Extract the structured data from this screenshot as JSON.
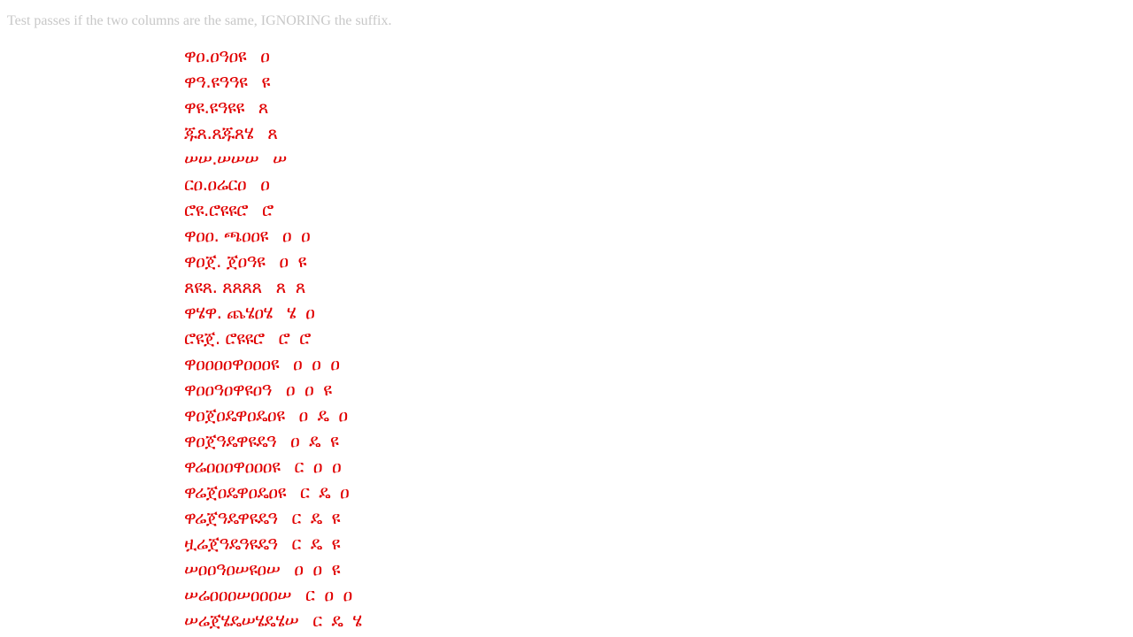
{
  "header": {
    "instruction": "Test passes if the two columns are the same, IGNORING the suffix."
  },
  "rows": [
    {
      "glyphs": "ዋዐ.ዐዓዐዩ",
      "suffix": "ዐ"
    },
    {
      "glyphs": "ዋዓ.ዩዓዓዩ",
      "suffix": "ዩ"
    },
    {
      "glyphs": "ዋዩ.ዩዓዩዩ",
      "suffix": "ጸ"
    },
    {
      "glyphs": "ጁጸ.ጸጁጸሄ",
      "suffix": "ጸ"
    },
    {
      "glyphs": "ሠሠ.ሠሠሠ",
      "suffix": "ሠ"
    },
    {
      "glyphs": "ርዐ.ዐሬርዐ",
      "suffix": "ዐ"
    },
    {
      "glyphs": "ሮዩ.ሮዩዩሮ",
      "suffix": "ሮ"
    },
    {
      "glyphs": "ዋዐዐ. ጫዐዐዩ",
      "suffix": "ዐ ዐ"
    },
    {
      "glyphs": "ዋዐጀ. ጀዐዓዩ",
      "suffix": "ዐ ዩ"
    },
    {
      "glyphs": "ጸዩጸ. ጸጸጸጸ",
      "suffix": "ጸ ጸ"
    },
    {
      "glyphs": "ዋሄዋ. ጨሄዐሄ",
      "suffix": "ሄ ዐ"
    },
    {
      "glyphs": "ሮዩጀ. ሮዩዩሮ",
      "suffix": "ሮ ሮ"
    },
    {
      "glyphs": "ዋዐዐዐዐዋዐዐዐዩ",
      "suffix": "ዐ ዐ ዐ"
    },
    {
      "glyphs": "ዋዐዐዓዐዋዩዐዓ",
      "suffix": "ዐ ዐ ዩ"
    },
    {
      "glyphs": "ዋዐጀዐዴዋዐዴዐዩ",
      "suffix": "ዐ ዴ ዐ"
    },
    {
      "glyphs": "ዋዐጀዓዴዋዩዴዓ",
      "suffix": "ዐ ዴ ዩ"
    },
    {
      "glyphs": "ዋሬዐዐዐዋዐዐዐዩ",
      "suffix": "ር ዐ ዐ"
    },
    {
      "glyphs": "ዋሬጀዐዴዋዐዴዐዩ",
      "suffix": "ር ዴ ዐ"
    },
    {
      "glyphs": "ዋሬጀዓዴዋዩዴዓ",
      "suffix": "ር ዴ ዩ"
    },
    {
      "glyphs": "ዟሬጀዓዴዓዩዴዓ",
      "suffix": "ር ዴ ዩ"
    },
    {
      "glyphs": "ሠዐዐዓዐሠዩዐሠ",
      "suffix": "ዐ ዐ ዩ"
    },
    {
      "glyphs": "ሠሬዐዐዐሠዐዐዐሠ",
      "suffix": "ር ዐ ዐ"
    },
    {
      "glyphs": "ሠሬጀሄዴሠሄዴሄሠ",
      "suffix": "ር ዴ ሄ"
    }
  ],
  "colors": {
    "glyph": "#e00000",
    "instruction": "#c8c8c8",
    "background": "#ffffff"
  }
}
